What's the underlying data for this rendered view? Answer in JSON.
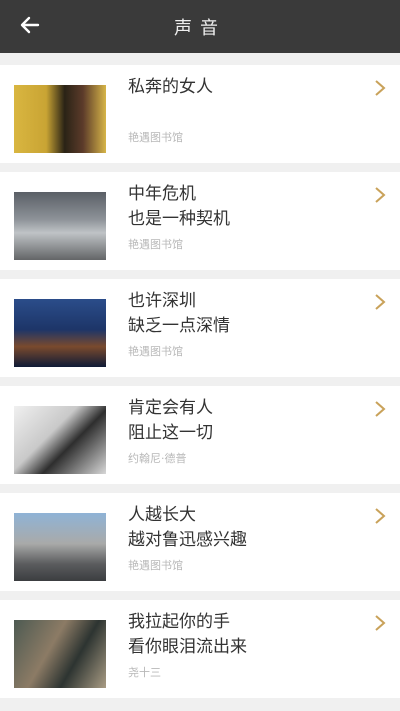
{
  "header": {
    "title": "声音",
    "back_icon": "arrow-left-icon"
  },
  "accent_color": "#c9a25a",
  "items": [
    {
      "title_line1": "私奔的女人",
      "title_line2": "",
      "author": "艳遇图书馆"
    },
    {
      "title_line1": "中年危机",
      "title_line2": "也是一种契机",
      "author": "艳遇图书馆"
    },
    {
      "title_line1": "也许深圳",
      "title_line2": "缺乏一点深情",
      "author": "艳遇图书馆"
    },
    {
      "title_line1": "肯定会有人",
      "title_line2": "阻止这一切",
      "author": "约翰尼·德普"
    },
    {
      "title_line1": "人越长大",
      "title_line2": "越对鲁迅感兴趣",
      "author": "艳遇图书馆"
    },
    {
      "title_line1": "我拉起你的手",
      "title_line2": "看你眼泪流出来",
      "author": "尧十三"
    }
  ]
}
